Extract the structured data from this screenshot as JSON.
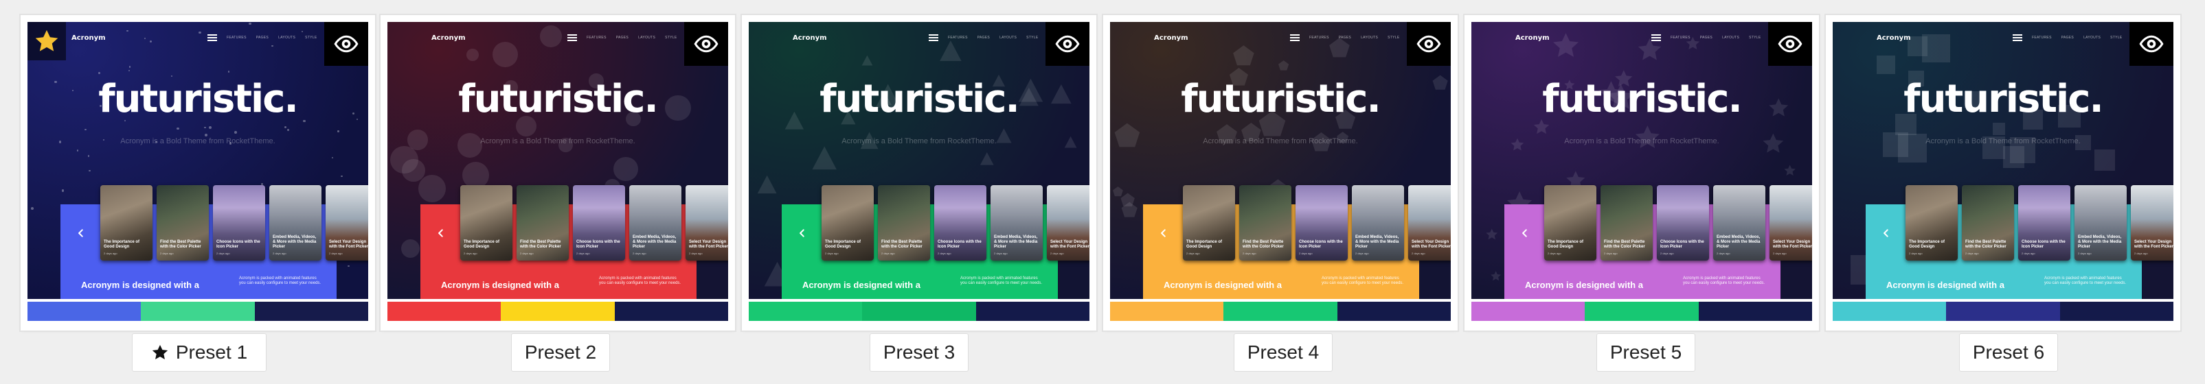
{
  "theme": {
    "logo": "Acronym",
    "nav_links": [
      "FEATURES",
      "PAGES",
      "LAYOUTS",
      "STYLE"
    ],
    "hero_title": "futuristic.",
    "hero_subtitle": "Acronym is a Bold Theme from RocketTheme.",
    "panel_heading": "Acronym is designed with a",
    "panel_text": "Acronym is packed with animated features you can easily configure to meet your needs.",
    "cards": [
      {
        "title": "The Importance of Good Design",
        "meta": "2 days ago"
      },
      {
        "title": "Find the Best Palette with the Color Picker",
        "meta": "2 days ago"
      },
      {
        "title": "Choose Icons with the Icon Picker",
        "meta": "2 days ago"
      },
      {
        "title": "Embed Media, Videos, & More with the Media Picker",
        "meta": "2 days ago"
      },
      {
        "title": "Select Your Design with the Font Picker",
        "meta": "2 days ago"
      }
    ]
  },
  "presets": [
    {
      "label": "Preset 1",
      "active": true,
      "bg_top": "#1d2170",
      "bg_bottom": "#0f1240",
      "accent": "#4c5ef0",
      "shapes": "dots",
      "swatches": [
        "#4a66e6",
        "#3ed68f",
        "#161b4b"
      ]
    },
    {
      "label": "Preset 2",
      "active": false,
      "bg_top": "#4a1526",
      "bg_bottom": "#141433",
      "accent": "#e8383d",
      "shapes": "circles",
      "swatches": [
        "#ee3a3d",
        "#fbd51a",
        "#141a4a"
      ]
    },
    {
      "label": "Preset 3",
      "active": false,
      "bg_top": "#0f3a33",
      "bg_bottom": "#121433",
      "accent": "#12c46e",
      "shapes": "triangles",
      "swatches": [
        "#19c872",
        "#0fb865",
        "#141a4a"
      ]
    },
    {
      "label": "Preset 4",
      "active": false,
      "bg_top": "#3a2a22",
      "bg_bottom": "#131433",
      "accent": "#fbb13d",
      "shapes": "pentagons",
      "swatches": [
        "#fcb442",
        "#17c873",
        "#141a4a"
      ]
    },
    {
      "label": "Preset 5",
      "active": false,
      "bg_top": "#3c1f5e",
      "bg_bottom": "#141433",
      "accent": "#c56ad8",
      "shapes": "stars",
      "swatches": [
        "#c76cd9",
        "#17c873",
        "#141a4a"
      ]
    },
    {
      "label": "Preset 6",
      "active": false,
      "bg_top": "#123042",
      "bg_bottom": "#141433",
      "accent": "#47c9d1",
      "shapes": "squares",
      "swatches": [
        "#46c9d0",
        "#2b2f8a",
        "#141a4a"
      ]
    }
  ],
  "icons": {
    "preview": "eye-icon",
    "active_preset": "star-icon",
    "carousel_prev": "chevron-left-icon",
    "preset_selected": "star-icon"
  }
}
